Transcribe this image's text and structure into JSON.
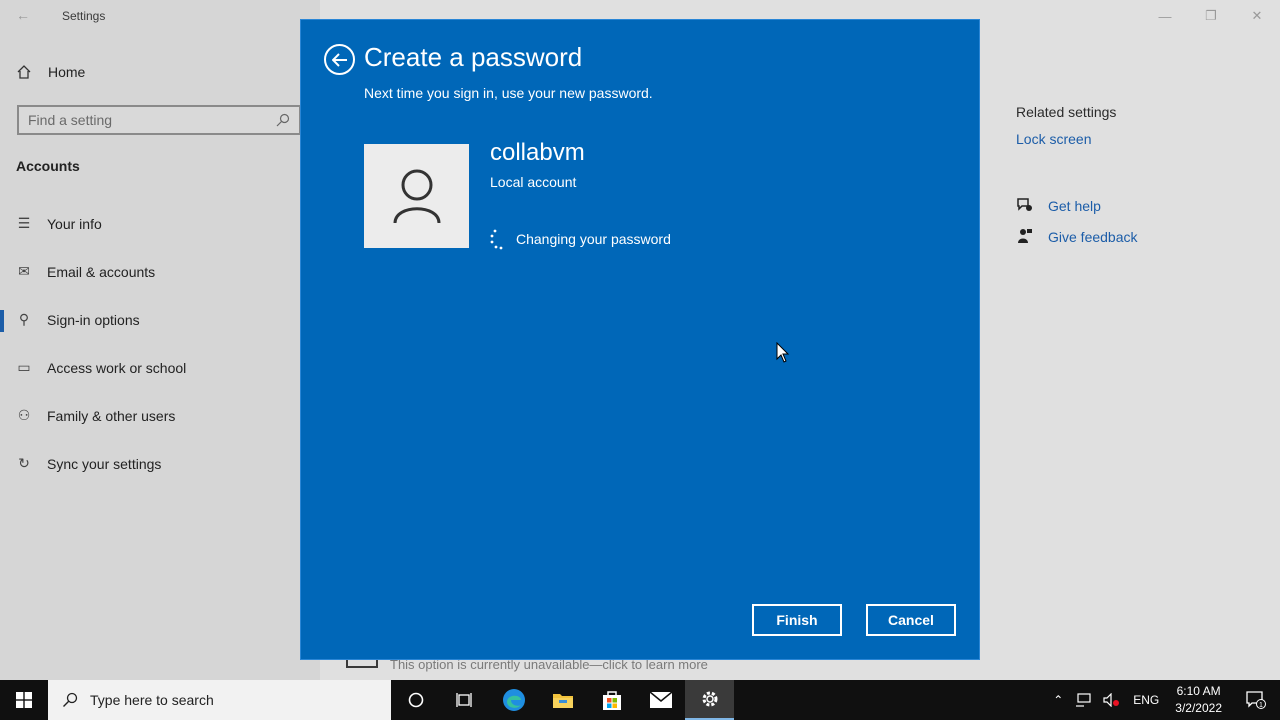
{
  "window": {
    "title": "Settings",
    "controls": {
      "minimize": "—",
      "restore": "❐",
      "close": "✕"
    }
  },
  "sidebar": {
    "home_label": "Home",
    "search_placeholder": "Find a setting",
    "section_label": "Accounts",
    "items": [
      {
        "label": "Your info",
        "icon": "person-card-icon"
      },
      {
        "label": "Email & accounts",
        "icon": "mail-icon"
      },
      {
        "label": "Sign-in options",
        "icon": "key-icon",
        "selected": true
      },
      {
        "label": "Access work or school",
        "icon": "briefcase-icon"
      },
      {
        "label": "Family & other users",
        "icon": "person-add-icon"
      },
      {
        "label": "Sync your settings",
        "icon": "sync-icon"
      }
    ]
  },
  "related": {
    "title": "Related settings",
    "lock_screen": "Lock screen",
    "get_help": "Get help",
    "give_feedback": "Give feedback"
  },
  "bottom_note": "This option is currently unavailable—click to learn more",
  "dialog": {
    "title": "Create a password",
    "subtitle": "Next time you sign in, use your new password.",
    "username": "collabvm",
    "account_type": "Local account",
    "status": "Changing your password",
    "finish_label": "Finish",
    "cancel_label": "Cancel",
    "background_color": "#0067b8"
  },
  "taskbar": {
    "search_placeholder": "Type here to search",
    "language": "ENG",
    "time": "6:10 AM",
    "date": "3/2/2022",
    "notification_count": "1"
  }
}
